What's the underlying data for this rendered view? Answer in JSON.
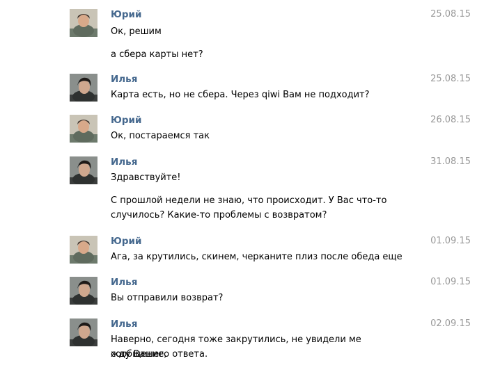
{
  "conversation": {
    "messages": [
      {
        "author": "Юрий",
        "date": "25.08.15",
        "avatar": "yuri-avatar",
        "lines": [
          "Ок, решим",
          "а сбера карты нет?"
        ]
      },
      {
        "author": "Илья",
        "date": "25.08.15",
        "avatar": "ilya-avatar",
        "lines": [
          "Карта есть, но не сбера. Через qiwi Вам не подходит?"
        ]
      },
      {
        "author": "Юрий",
        "date": "26.08.15",
        "avatar": "yuri-avatar",
        "lines": [
          "Ок, постараемся так"
        ]
      },
      {
        "author": "Илья",
        "date": "31.08.15",
        "avatar": "ilya-avatar",
        "lines": [
          "Здравствуйте!",
          "С прошлой недели не знаю, что происходит. У Вас что-то",
          "случилось? Какие-то проблемы с возвратом?"
        ]
      },
      {
        "author": "Юрий",
        "date": "01.09.15",
        "avatar": "yuri-avatar",
        "lines": [
          "Ага, за крутились, скинем, черканите плиз после обеда еще"
        ]
      },
      {
        "author": "Илья",
        "date": "01.09.15",
        "avatar": "ilya-avatar",
        "lines": [
          "Вы отправили возврат?"
        ]
      },
      {
        "author": "Илья",
        "date": "02.09.15",
        "avatar": "ilya-avatar",
        "lines": [
          "Наверно, сегодня тоже закрутились, не увидели ме сообщение,",
          "жду Вашего ответа."
        ]
      }
    ]
  }
}
